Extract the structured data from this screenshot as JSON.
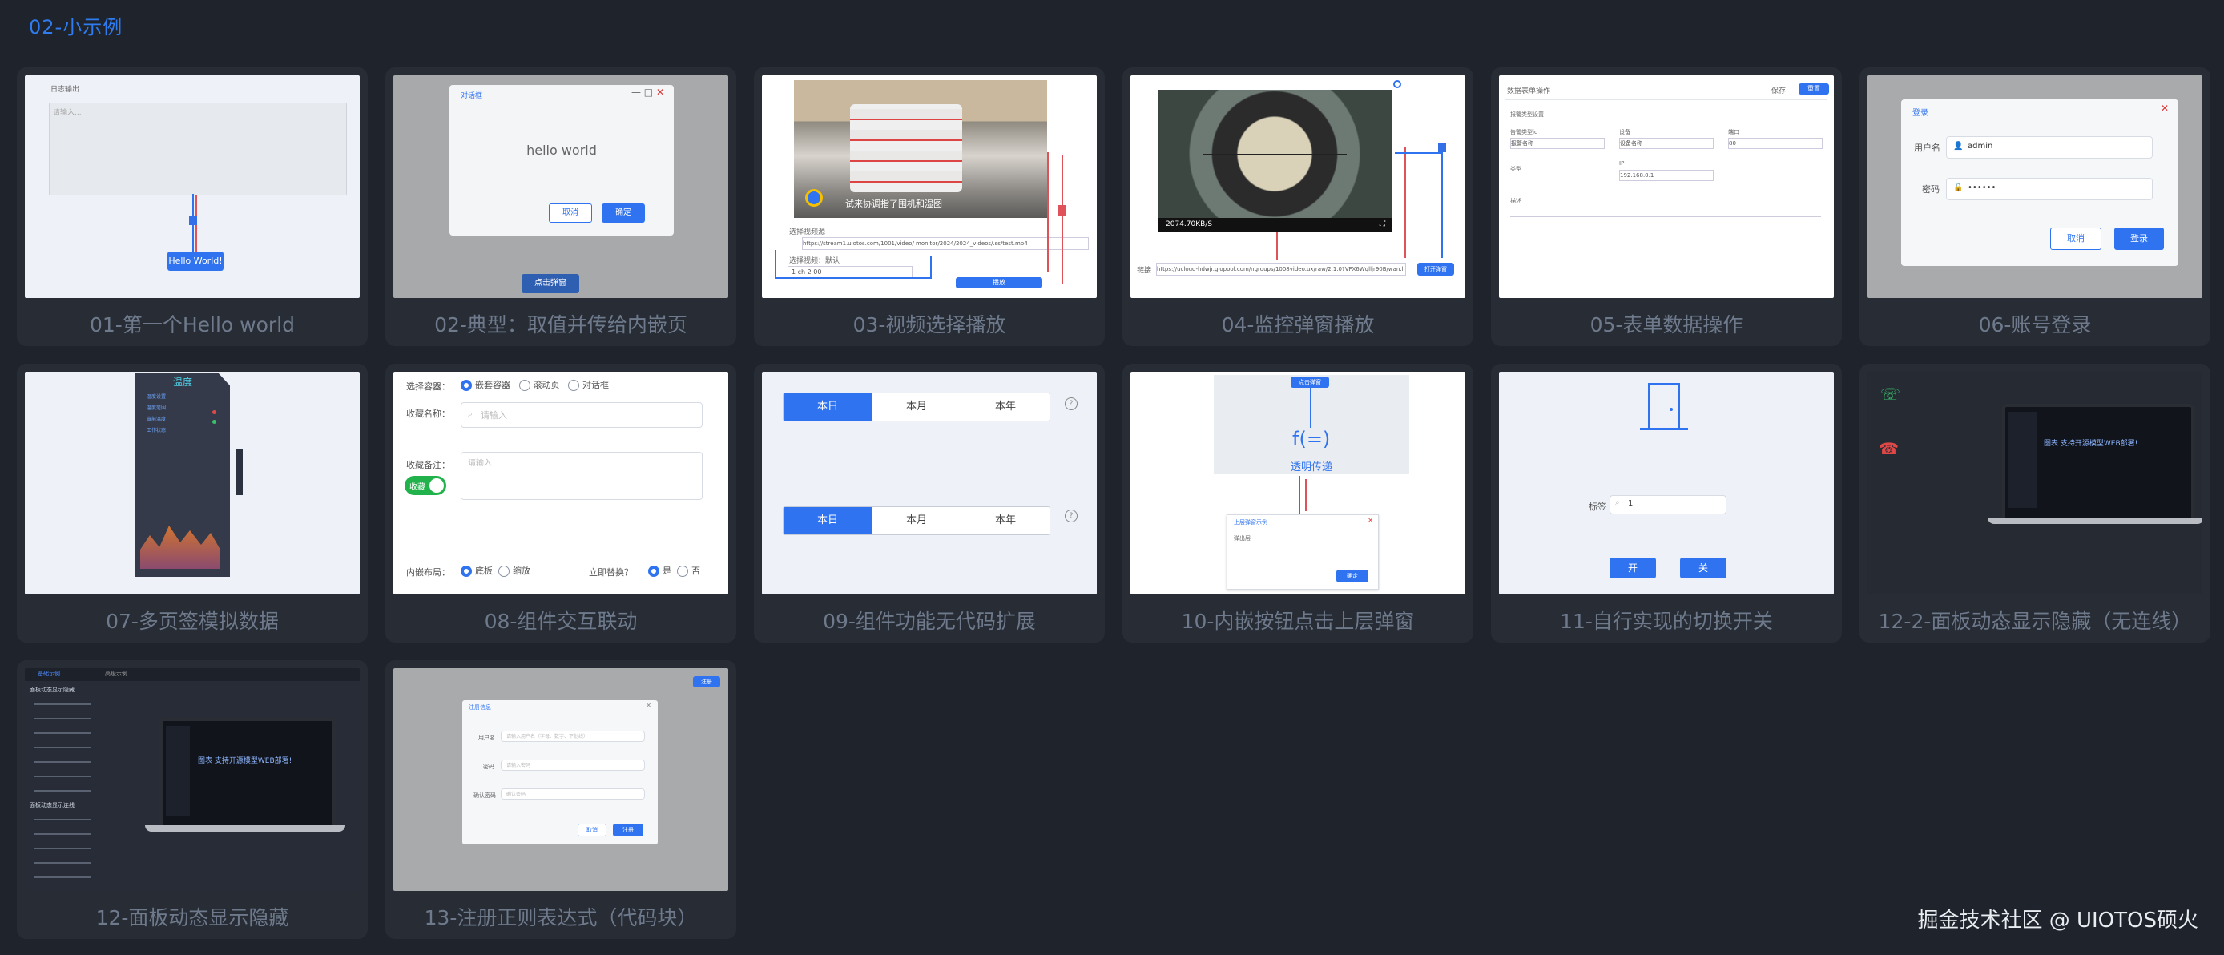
{
  "section_title": "02-小示例",
  "footer": "掘金技术社区 @ UIOTOS硕火",
  "cards": [
    {
      "caption": "01-第一个Hello world",
      "button": "Hello World!",
      "panel_title": "日志输出",
      "panel_placeholder": "请输入..."
    },
    {
      "caption": "02-典型：取值并传给内嵌页",
      "dialog_title": "对话框",
      "dialog_text": "hello world",
      "cancel": "取消",
      "confirm": "确定",
      "open_button": "点击弹窗"
    },
    {
      "caption": "03-视频选择播放",
      "video_text": "试来协调指了围机和湿图",
      "label": "选择视频源",
      "url": "https://stream1.uiotos.com/1001/video/ monitor/2024/2024_videos/.ss/test.mp4",
      "select": "选择视频：默认",
      "select_value": "1 ch 2 00",
      "play": "播放"
    },
    {
      "caption": "04-监控弹窗播放",
      "speed": "2074.70KB/S",
      "url_label": "链接",
      "url": "https://ucloud-hdwjr.glopool.com/ngroups/1008video.ux/raw/2.1.0?VFX6Wqlljr90B/wan.live.flv",
      "button": "打开弹窗"
    },
    {
      "caption": "05-表单数据操作",
      "form_title": "数据表单操作",
      "save": "保存",
      "reset": "重置",
      "group_label": "报警类型设置",
      "fields": [
        "告警类型id",
        "设备",
        "端口",
        "IP",
        "类型",
        "描述"
      ],
      "values": [
        "报警名称",
        "设备名称",
        "80",
        "192.168.0.1"
      ]
    },
    {
      "caption": "06-账号登录",
      "title": "登录",
      "user_label": "用户名",
      "user_value": "admin",
      "pwd_label": "密码",
      "pwd_value": "••••••",
      "cancel": "取消",
      "login": "登录"
    },
    {
      "caption": "07-多页签模拟数据",
      "panel_title": "温度",
      "rows": [
        "温度设置",
        "温度范围",
        "当前温度",
        "工作状态"
      ]
    },
    {
      "caption": "08-组件交互联动",
      "container_label": "选择容器：",
      "options": [
        "嵌套容器",
        "滚动页",
        "对话框"
      ],
      "name_label": "收藏名称：",
      "name_placeholder": "请输入",
      "note_label": "收藏备注：",
      "note_placeholder": "请输入",
      "toggle_label": "收藏",
      "layout_label": "内嵌布局：",
      "layout_options": [
        "底板",
        "缩放"
      ],
      "replace_label": "立即替换？",
      "replace_options": [
        "是",
        "否"
      ]
    },
    {
      "caption": "09-组件功能无代码扩展",
      "segments": [
        "本日",
        "本月",
        "本年"
      ]
    },
    {
      "caption": "10-内嵌按钮点击上层弹窗",
      "top_button": "点击弹窗",
      "icon_text": "f(=)",
      "label": "透明传递",
      "dialog_title": "上层弹窗示例",
      "dialog_text": "弹出层",
      "dialog_button": "确定"
    },
    {
      "caption": "11-自行实现的切换开关",
      "field_label": "标签",
      "field_value": "1",
      "on": "开",
      "off": "关"
    },
    {
      "caption": "12-2-面板动态显示隐藏（无连线）",
      "screen_text": "图表 支持开源模型WEB部署!"
    },
    {
      "caption": "12-面板动态显示隐藏",
      "tabs": [
        "基础示例",
        "高级示例"
      ],
      "heading1": "面板动态显示隐藏",
      "heading2": "面板动态显示连线",
      "screen_text": "图表 支持开源模型WEB部署!"
    },
    {
      "caption": "13-注册正则表达式（代码块）",
      "dialog_title": "注册信息",
      "fields": [
        "用户名",
        "密码",
        "确认密码"
      ],
      "placeholders": [
        "请输入用户名（字母、数字、下划线）",
        "请输入密码",
        "确认密码"
      ],
      "cancel": "取消",
      "submit": "注册",
      "top_button": "注册"
    }
  ]
}
